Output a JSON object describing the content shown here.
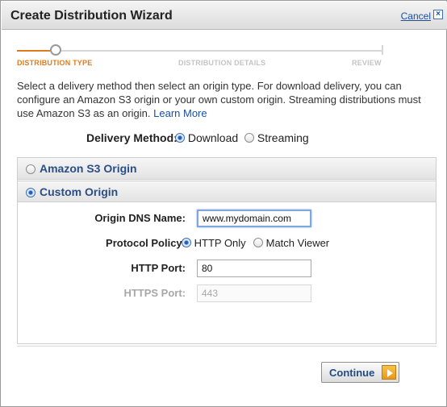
{
  "dialog": {
    "title": "Create Distribution Wizard",
    "cancel_label": "Cancel",
    "close_icon": "close-icon"
  },
  "steps": [
    {
      "label": "DISTRIBUTION TYPE",
      "state": "active"
    },
    {
      "label": "DISTRIBUTION DETAILS",
      "state": "pending"
    },
    {
      "label": "REVIEW",
      "state": "pending"
    }
  ],
  "intro": {
    "text": "Select a delivery method then select an origin type. For download delivery, you can configure an Amazon S3 origin or your own custom origin. Streaming distributions must use Amazon S3 as an origin.",
    "link": "Learn More"
  },
  "delivery": {
    "label": "Delivery Method:",
    "options": [
      {
        "label": "Download",
        "selected": true
      },
      {
        "label": "Streaming",
        "selected": false
      }
    ]
  },
  "origins": {
    "s3": {
      "label": "Amazon S3 Origin",
      "selected": false
    },
    "custom": {
      "label": "Custom Origin",
      "selected": true
    }
  },
  "form": {
    "dns": {
      "label": "Origin DNS Name:",
      "value": "www.mydomain.com"
    },
    "protocol": {
      "label": "Protocol Policy:",
      "options": [
        {
          "label": "HTTP Only",
          "selected": true
        },
        {
          "label": "Match Viewer",
          "selected": false
        }
      ]
    },
    "http_port": {
      "label": "HTTP Port:",
      "value": "80"
    },
    "https_port": {
      "label": "HTTPS Port:",
      "value": "443",
      "disabled": true
    }
  },
  "footer": {
    "continue_label": "Continue",
    "continue_icon": "arrow-right-icon"
  },
  "colors": {
    "accent": "#e07b1a",
    "link": "#1a4fa8",
    "section_header_text": "#2a4e85",
    "continue_arrow": "#e99a13"
  }
}
